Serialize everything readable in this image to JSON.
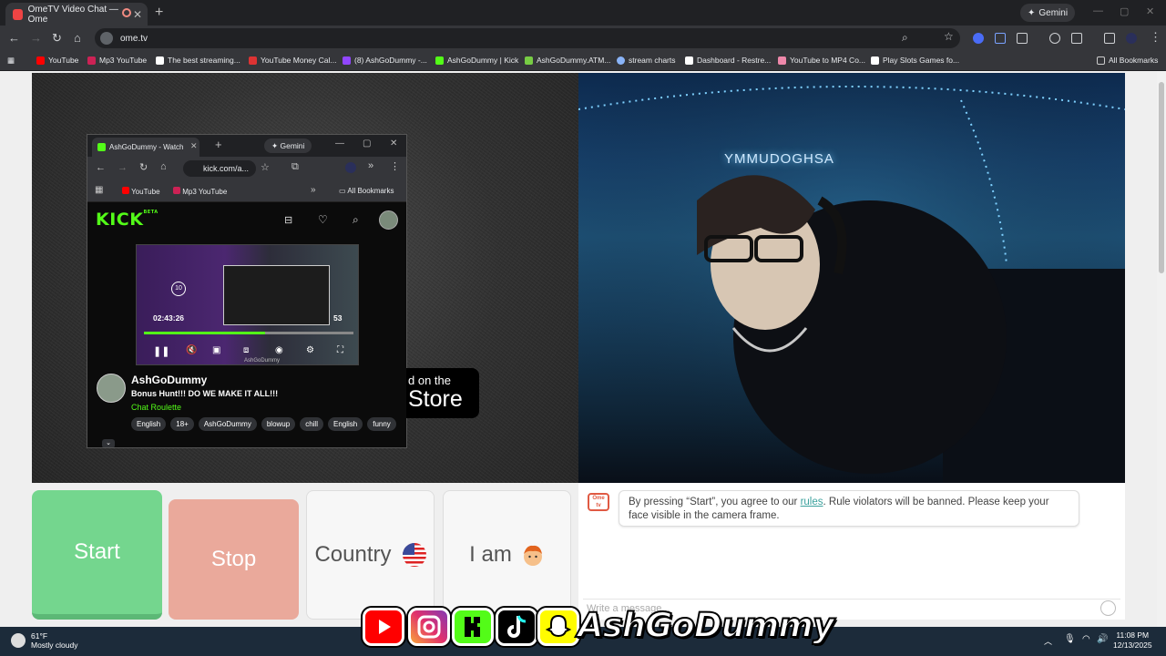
{
  "browser": {
    "tab_title": "OmeTV Video Chat — Ome",
    "gemini_label": "Gemini",
    "url": "ome.tv",
    "bookmarks": [
      "YouTube",
      "Mp3 YouTube",
      "The best streaming...",
      "YouTube Money Cal...",
      "(8) AshGoDummy -...",
      "AshGoDummy | Kick",
      "AshGoDummy.ATM...",
      "stream charts",
      "Dashboard - Restre...",
      "YouTube to MP4 Co...",
      "Play Slots Games fo..."
    ],
    "all_bookmarks": "All Bookmarks"
  },
  "embed": {
    "tab_title": "AshGoDummy - Watch",
    "gemini_label": "Gemini",
    "url": "kick.com/a...",
    "bookmarks": [
      "YouTube",
      "Mp3 YouTube"
    ],
    "all_bookmarks": "All Bookmarks",
    "logo": "KICK",
    "logo_sup": "BETA",
    "player_time": "02:43:26",
    "player_time_end": "53",
    "player_replay": "10",
    "channel_name": "AshGoDummy",
    "stream_title": "Bonus Hunt!!! DO WE MAKE IT ALL!!!",
    "category": "Chat Roulette",
    "tags": [
      "English",
      "18+",
      "AshGoDummy",
      "blowup",
      "chill",
      "English",
      "funny"
    ],
    "video_watermark": "AshGoDummy"
  },
  "appstore": {
    "line1": "d on the",
    "line2": "Store"
  },
  "remote_video": {
    "neon_sign": "YMMUDOGHSA"
  },
  "controls": {
    "start": "Start",
    "stop": "Stop",
    "country": "Country",
    "iam": "I am"
  },
  "chat": {
    "logo": "Ome tv",
    "notice_before": "By pressing “Start”, you agree to our ",
    "notice_link": "rules",
    "notice_after": ". Rule violators will be banned. Please keep your face visible in the camera frame.",
    "input_placeholder": "Write a message..."
  },
  "taskbar": {
    "temp": "61°F",
    "condition": "Mostly cloudy",
    "time": "11:08 PM",
    "date": "12/13/2025"
  },
  "overlay": {
    "handle": "AshGoDummy"
  },
  "colors": {
    "start": "#74d68e",
    "stop": "#eaa99b",
    "kick_green": "#53fc18",
    "link": "#3ba19d"
  }
}
